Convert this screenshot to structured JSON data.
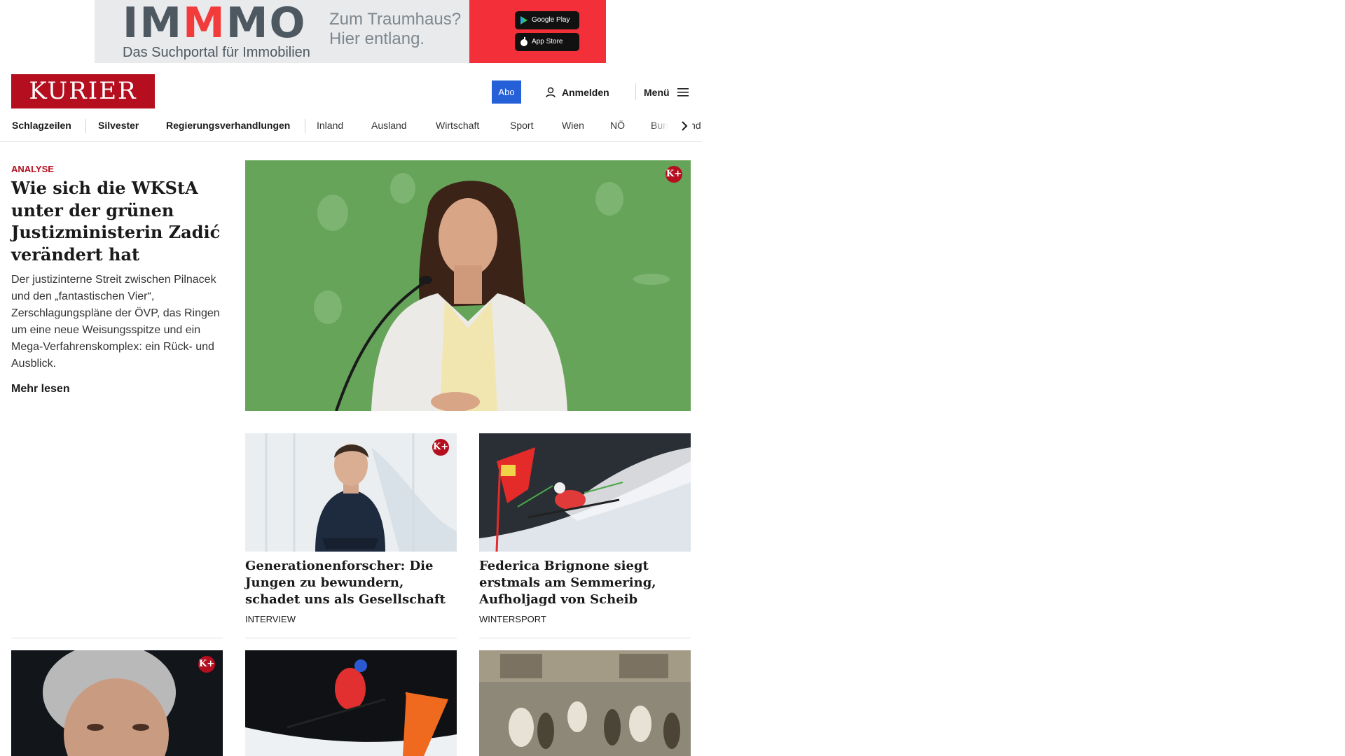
{
  "ad": {
    "brand_start": "IM",
    "brand_mid": "M",
    "brand_end": "MO",
    "tagline": "Das Suchportal für Immobilien",
    "claim_line1": "Zum Traumhaus?",
    "claim_line2": "Hier entlang.",
    "google_play": "Google Play",
    "app_store": "App Store"
  },
  "header": {
    "logo": "KURIER",
    "abo": "Abo",
    "login": "Anmelden",
    "menu": "Menü"
  },
  "nav": {
    "items": [
      "Schlagzeilen",
      "Silvester",
      "Regierungsverhandlungen",
      "Inland",
      "Ausland",
      "Wirtschaft",
      "Sport",
      "Wien",
      "NÖ",
      "Burgenland"
    ]
  },
  "lead": {
    "kicker": "ANALYSE",
    "title": "Wie sich die WKStA unter der grünen Justizministerin Zadić verändert hat",
    "teaser": "Der justizinterne Streit zwischen Pilnacek und den „fantastischen Vier“, Zerschlagungspläne der ÖVP, das Ringen um eine neue Weisungsspitze und ein Mega-Verfahrenskomplex: ein Rück- und Ausblick.",
    "more": "Mehr lesen",
    "badge": "K+"
  },
  "cards": [
    {
      "title": "Generationenforscher: Die Jungen zu bewundern, schadet uns als Gesellschaft",
      "category": "INTERVIEW",
      "badge": "K+"
    },
    {
      "title": "Federica Brignone siegt erstmals am Semmering, Aufholjagd von Scheib",
      "category": "WINTERSPORT"
    }
  ],
  "bottom_cards": [
    {
      "badge": "K+"
    },
    {},
    {}
  ],
  "colors": {
    "brand_red": "#b50f1f",
    "abo_blue": "#2560d9",
    "ad_red": "#f3303a"
  }
}
